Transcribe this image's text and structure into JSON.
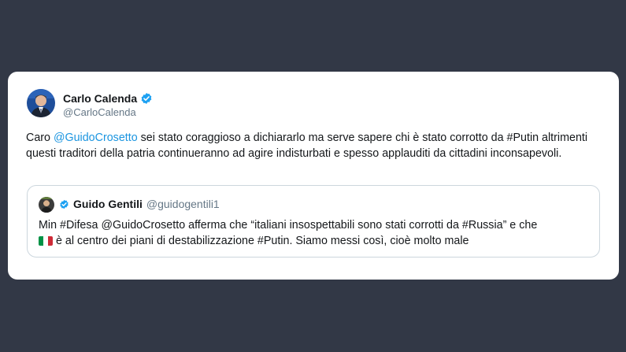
{
  "tweet": {
    "author": {
      "display_name": "Carlo Calenda",
      "handle": "@CarloCalenda",
      "verified_icon": "verified-badge-icon"
    },
    "text": {
      "prefix": "Caro ",
      "mention": "@GuidoCrosetto",
      "body": " sei stato coraggioso a dichiararlo ma serve sapere chi è stato corrotto da #Putin altrimenti questi traditori della patria continueranno ad agire indisturbati e spesso applauditi da cittadini inconsapevoli."
    },
    "quoted": {
      "display_name": "Guido Gentili",
      "handle": "@guidogentili1",
      "verified_icon": "verified-badge-icon",
      "line1": "Min #Difesa @GuidoCrosetto afferma che “italiani insospettabili sono stati corrotti da #Russia” e che",
      "flag_icon": "italy-flag-icon",
      "line2": "è al centro dei piani di destabilizzazione #Putin. Siamo messi così, cioè molto male"
    }
  },
  "colors": {
    "background": "#323846",
    "card": "#ffffff",
    "link": "#1b95e0",
    "verified": "#1da1f2",
    "secondary_text": "#657786",
    "border": "#ccd6dd"
  }
}
